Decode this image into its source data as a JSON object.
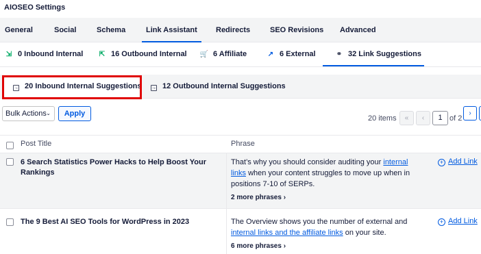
{
  "settings_title": "AIOSEO Settings",
  "main_tabs": [
    {
      "label": "General"
    },
    {
      "label": "Social"
    },
    {
      "label": "Schema"
    },
    {
      "label": "Link Assistant"
    },
    {
      "label": "Redirects"
    },
    {
      "label": "SEO Revisions"
    },
    {
      "label": "Advanced"
    }
  ],
  "link_tabs": [
    {
      "label": "0 Inbound Internal",
      "icon": "inbound-arrow-icon"
    },
    {
      "label": "16 Outbound Internal",
      "icon": "outbound-arrow-icon"
    },
    {
      "label": "6 Affiliate",
      "icon": "cart-icon"
    },
    {
      "label": "6 External",
      "icon": "external-link-icon"
    },
    {
      "label": "32 Link Suggestions",
      "icon": "chain-link-icon"
    }
  ],
  "suggestion_tabs": [
    {
      "label": "20 Inbound Internal Suggestions",
      "icon": "inbound-box-icon"
    },
    {
      "label": "12 Outbound Internal Suggestions",
      "icon": "outbound-box-icon"
    }
  ],
  "toolbar": {
    "bulk_actions": "Bulk Actions",
    "apply": "Apply",
    "items_count": "20 items",
    "current_page": "1",
    "page_total": "of 2"
  },
  "table": {
    "col_post_title": "Post Title",
    "col_phrase": "Phrase",
    "rows": [
      {
        "title": "6 Search Statistics Power Hacks to Help Boost Your Rankings",
        "phrase_before": "That’s why you should consider auditing your ",
        "phrase_link": "internal links",
        "phrase_after": " when your content struggles to move up when in positions 7-10 of SERPs.",
        "more": "2 more phrases",
        "action": "Add Link"
      },
      {
        "title": "The 9 Best AI SEO Tools for WordPress in 2023",
        "phrase_before": "The Overview shows you the number of external and ",
        "phrase_link": "internal links and the affiliate links",
        "phrase_after": " on your site.",
        "more": "6 more phrases",
        "action": "Add Link"
      }
    ]
  },
  "colors": {
    "accent": "#005ae0",
    "highlight": "#e00000",
    "text": "#141b38"
  }
}
